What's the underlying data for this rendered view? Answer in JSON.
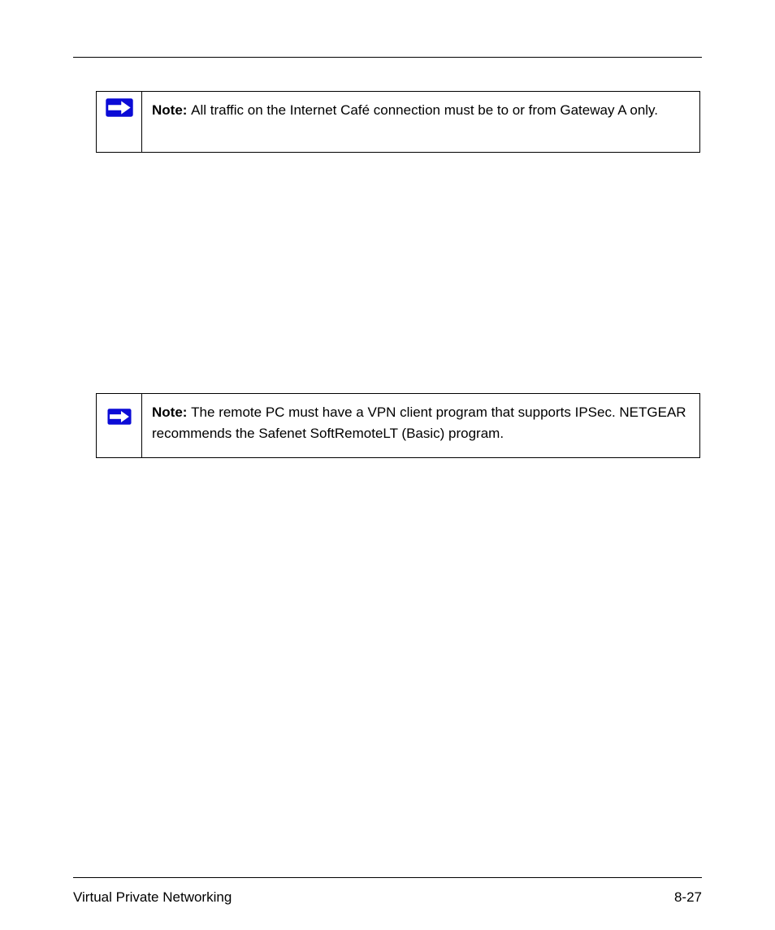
{
  "footer": {
    "left": "Virtual Private Networking",
    "right": "8-27"
  },
  "notes": [
    {
      "prefix": "Note: ",
      "body": "All traffic on the Internet Café connection must be to or from Gateway A only."
    },
    {
      "prefix": "Note: ",
      "body": "The remote PC must have a VPN client program that supports IPSec. NETGEAR recommends the Safenet SoftRemoteLT (Basic) program."
    }
  ]
}
